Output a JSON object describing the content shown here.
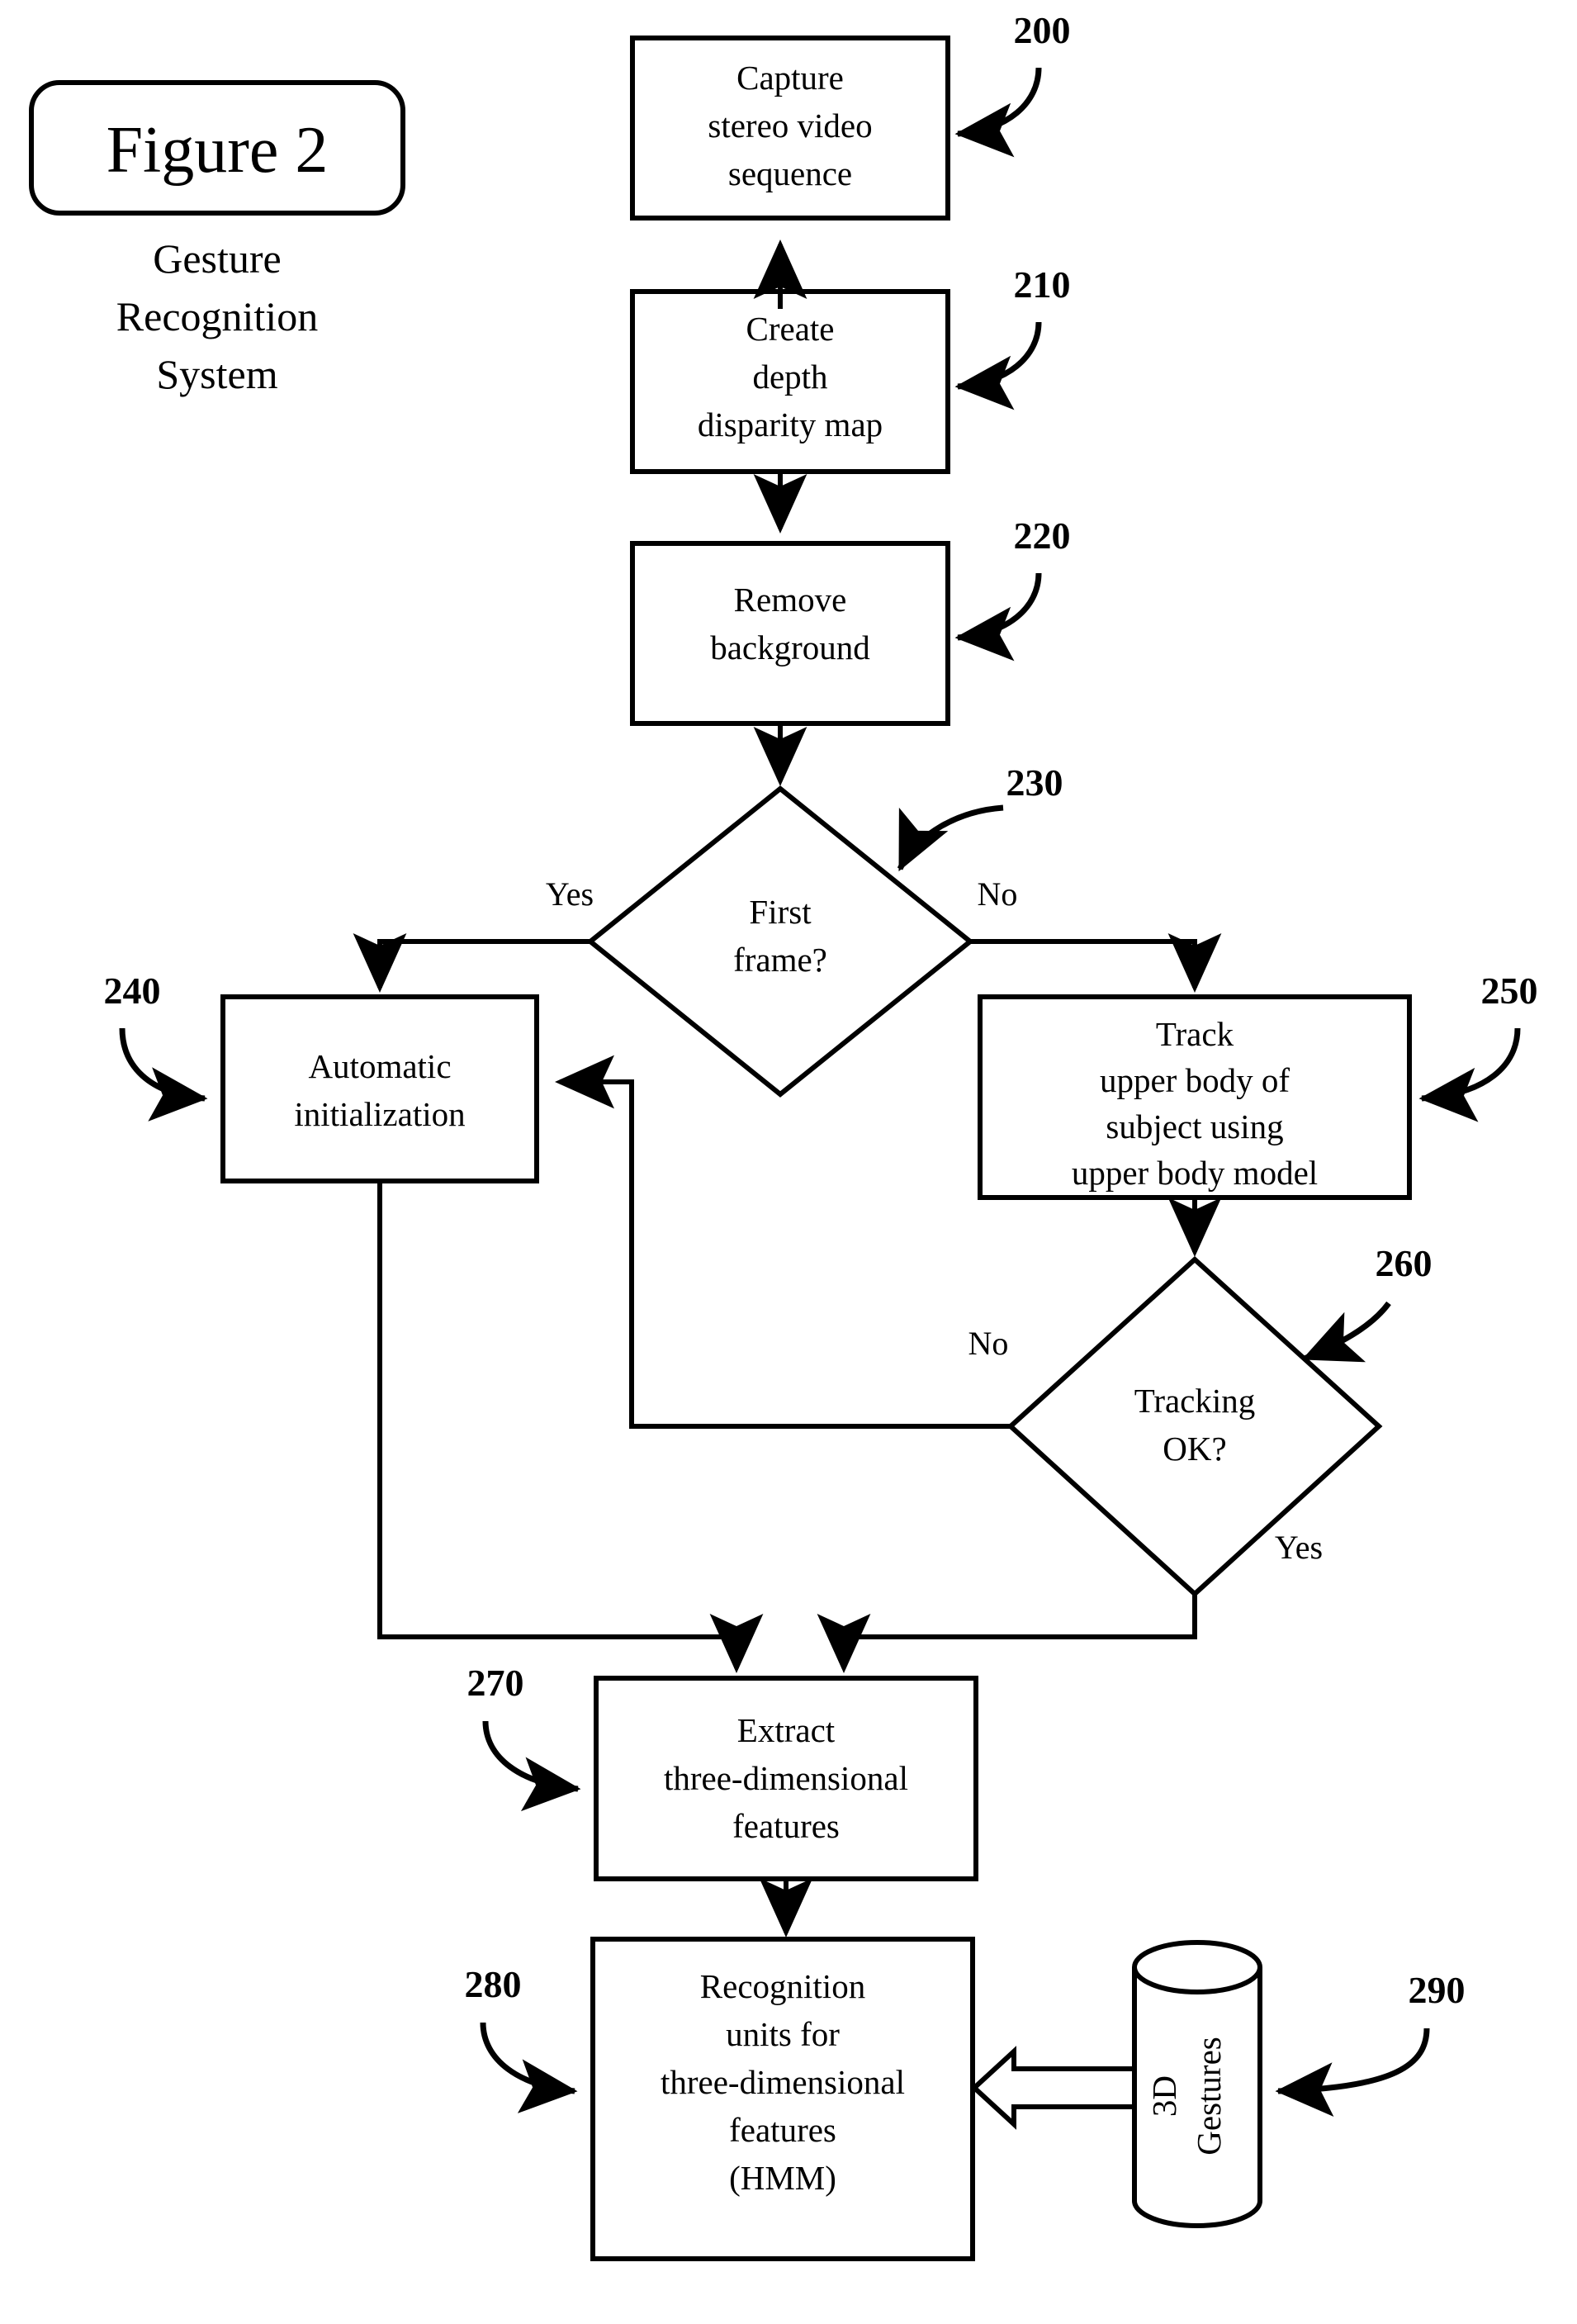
{
  "figure": {
    "title": "Figure 2",
    "subtitle_lines": [
      "Gesture",
      "Recognition",
      "System"
    ]
  },
  "nodes": [
    {
      "id": "capture",
      "ref": "200",
      "shape": "process",
      "lines": [
        "Capture",
        "stereo video",
        "sequence"
      ]
    },
    {
      "id": "depth-map",
      "ref": "210",
      "shape": "process",
      "lines": [
        "Create",
        "depth",
        "disparity map"
      ]
    },
    {
      "id": "remove-background",
      "ref": "220",
      "shape": "process",
      "lines": [
        "Remove",
        "background"
      ]
    },
    {
      "id": "first-frame",
      "ref": "230",
      "shape": "decision",
      "lines": [
        "First",
        "frame?"
      ]
    },
    {
      "id": "auto-init",
      "ref": "240",
      "shape": "process",
      "lines": [
        "Automatic",
        "initialization"
      ]
    },
    {
      "id": "track-upper-body",
      "ref": "250",
      "shape": "process",
      "lines": [
        "Track",
        "upper body of",
        "subject using",
        "upper body model"
      ]
    },
    {
      "id": "tracking-ok",
      "ref": "260",
      "shape": "decision",
      "lines": [
        "Tracking",
        "OK?"
      ]
    },
    {
      "id": "extract-features",
      "ref": "270",
      "shape": "process",
      "lines": [
        "Extract",
        "three-dimensional",
        "features"
      ]
    },
    {
      "id": "recognition-units",
      "ref": "280",
      "shape": "process",
      "lines": [
        "Recognition",
        "units for",
        "three-dimensional",
        "features",
        "(HMM)"
      ]
    },
    {
      "id": "gesture-database",
      "ref": "290",
      "shape": "cylinder",
      "lines": [
        "3D",
        "Gestures"
      ]
    }
  ],
  "branch_labels": {
    "first_frame_yes": "Yes",
    "first_frame_no": "No",
    "tracking_no": "No",
    "tracking_yes": "Yes"
  },
  "colors": {
    "ink": "#000000",
    "paper": "#ffffff"
  }
}
